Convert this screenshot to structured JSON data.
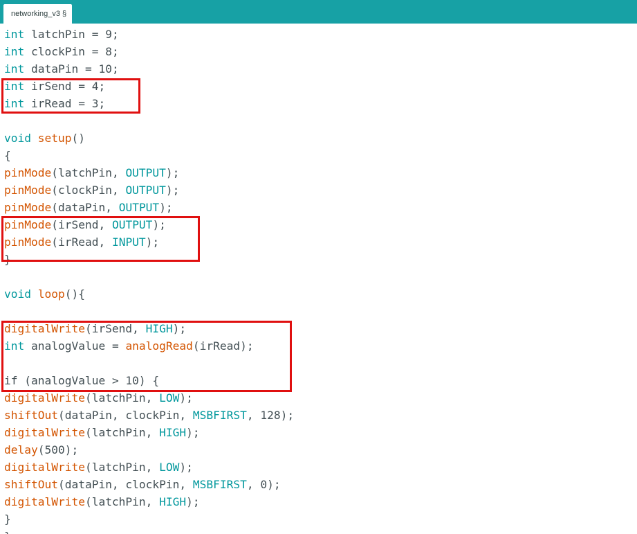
{
  "tab": {
    "name": "networking_v3",
    "modified_mark": "§"
  },
  "colors": {
    "tabbar": "#17a1a5",
    "keyword": "#00979c",
    "function": "#d35400",
    "text": "#434f54",
    "highlight": "#e01010"
  },
  "code": [
    [
      {
        "t": "int",
        "c": "kw"
      },
      {
        "t": " latchPin = 9;",
        "c": "plain"
      }
    ],
    [
      {
        "t": "int",
        "c": "kw"
      },
      {
        "t": " clockPin = 8;",
        "c": "plain"
      }
    ],
    [
      {
        "t": "int",
        "c": "kw"
      },
      {
        "t": " dataPin = 10;",
        "c": "plain"
      }
    ],
    [
      {
        "t": "int",
        "c": "kw"
      },
      {
        "t": " irSend = 4;",
        "c": "plain"
      }
    ],
    [
      {
        "t": "int",
        "c": "kw"
      },
      {
        "t": " irRead = 3;",
        "c": "plain"
      }
    ],
    [],
    [
      {
        "t": "void",
        "c": "kw"
      },
      {
        "t": " ",
        "c": "plain"
      },
      {
        "t": "setup",
        "c": "fn"
      },
      {
        "t": "()",
        "c": "plain"
      }
    ],
    [
      {
        "t": "{",
        "c": "plain"
      }
    ],
    [
      {
        "t": "pinMode",
        "c": "fn"
      },
      {
        "t": "(latchPin, ",
        "c": "plain"
      },
      {
        "t": "OUTPUT",
        "c": "cst"
      },
      {
        "t": ");",
        "c": "plain"
      }
    ],
    [
      {
        "t": "pinMode",
        "c": "fn"
      },
      {
        "t": "(clockPin, ",
        "c": "plain"
      },
      {
        "t": "OUTPUT",
        "c": "cst"
      },
      {
        "t": ");",
        "c": "plain"
      }
    ],
    [
      {
        "t": "pinMode",
        "c": "fn"
      },
      {
        "t": "(dataPin, ",
        "c": "plain"
      },
      {
        "t": "OUTPUT",
        "c": "cst"
      },
      {
        "t": ");",
        "c": "plain"
      }
    ],
    [
      {
        "t": "pinMode",
        "c": "fn"
      },
      {
        "t": "(irSend, ",
        "c": "plain"
      },
      {
        "t": "OUTPUT",
        "c": "cst"
      },
      {
        "t": ");",
        "c": "plain"
      }
    ],
    [
      {
        "t": "pinMode",
        "c": "fn"
      },
      {
        "t": "(irRead, ",
        "c": "plain"
      },
      {
        "t": "INPUT",
        "c": "cst"
      },
      {
        "t": ");",
        "c": "plain"
      }
    ],
    [
      {
        "t": "}",
        "c": "plain"
      }
    ],
    [],
    [
      {
        "t": "void",
        "c": "kw"
      },
      {
        "t": " ",
        "c": "plain"
      },
      {
        "t": "loop",
        "c": "fn"
      },
      {
        "t": "(){",
        "c": "plain"
      }
    ],
    [],
    [
      {
        "t": "digitalWrite",
        "c": "fn"
      },
      {
        "t": "(irSend, ",
        "c": "plain"
      },
      {
        "t": "HIGH",
        "c": "cst"
      },
      {
        "t": ");",
        "c": "plain"
      }
    ],
    [
      {
        "t": "int",
        "c": "kw"
      },
      {
        "t": " analogValue = ",
        "c": "plain"
      },
      {
        "t": "analogRead",
        "c": "fn"
      },
      {
        "t": "(irRead);",
        "c": "plain"
      }
    ],
    [],
    [
      {
        "t": "if",
        "c": "plain"
      },
      {
        "t": " (analogValue > 10) {",
        "c": "plain"
      }
    ],
    [
      {
        "t": "digitalWrite",
        "c": "fn"
      },
      {
        "t": "(latchPin, ",
        "c": "plain"
      },
      {
        "t": "LOW",
        "c": "cst"
      },
      {
        "t": ");",
        "c": "plain"
      }
    ],
    [
      {
        "t": "shiftOut",
        "c": "fn"
      },
      {
        "t": "(dataPin, clockPin, ",
        "c": "plain"
      },
      {
        "t": "MSBFIRST",
        "c": "cst"
      },
      {
        "t": ", 128);",
        "c": "plain"
      }
    ],
    [
      {
        "t": "digitalWrite",
        "c": "fn"
      },
      {
        "t": "(latchPin, ",
        "c": "plain"
      },
      {
        "t": "HIGH",
        "c": "cst"
      },
      {
        "t": ");",
        "c": "plain"
      }
    ],
    [
      {
        "t": "delay",
        "c": "fn"
      },
      {
        "t": "(500);",
        "c": "plain"
      }
    ],
    [
      {
        "t": "digitalWrite",
        "c": "fn"
      },
      {
        "t": "(latchPin, ",
        "c": "plain"
      },
      {
        "t": "LOW",
        "c": "cst"
      },
      {
        "t": ");",
        "c": "plain"
      }
    ],
    [
      {
        "t": "shiftOut",
        "c": "fn"
      },
      {
        "t": "(dataPin, clockPin, ",
        "c": "plain"
      },
      {
        "t": "MSBFIRST",
        "c": "cst"
      },
      {
        "t": ", 0);",
        "c": "plain"
      }
    ],
    [
      {
        "t": "digitalWrite",
        "c": "fn"
      },
      {
        "t": "(latchPin, ",
        "c": "plain"
      },
      {
        "t": "HIGH",
        "c": "cst"
      },
      {
        "t": ");",
        "c": "plain"
      }
    ],
    [
      {
        "t": "}",
        "c": "plain"
      }
    ],
    [
      {
        "t": "}",
        "c": "plain"
      }
    ]
  ]
}
